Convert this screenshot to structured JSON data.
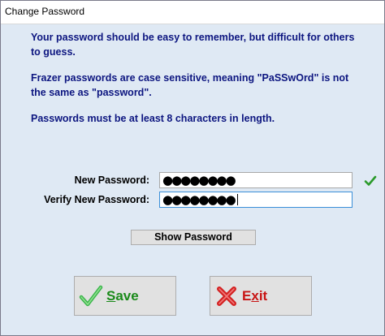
{
  "window": {
    "title": "Change Password"
  },
  "info": {
    "line1": "Your password should be easy to remember, but difficult for others to guess.",
    "line2": "Frazer passwords are case sensitive, meaning \"PaSSwOrd\" is not the same as \"password\".",
    "line3": "Passwords must be at least 8 characters in length."
  },
  "form": {
    "new_password_label": "New Password:",
    "new_password_value": "●●●●●●●●",
    "verify_password_label": "Verify New Password:",
    "verify_password_value": "●●●●●●●●"
  },
  "buttons": {
    "show_password": "Show Password",
    "save_prefix": "S",
    "save_rest": "ave",
    "exit_prefix": "E",
    "exit_mid": "x",
    "exit_rest": "it"
  },
  "colors": {
    "background": "#dfe9f4",
    "info_text": "#0d1680",
    "save_green": "#1a8a1a",
    "exit_red": "#c81414"
  },
  "icons": {
    "verified": "check-icon",
    "save": "checkmark-icon",
    "exit": "x-icon"
  }
}
